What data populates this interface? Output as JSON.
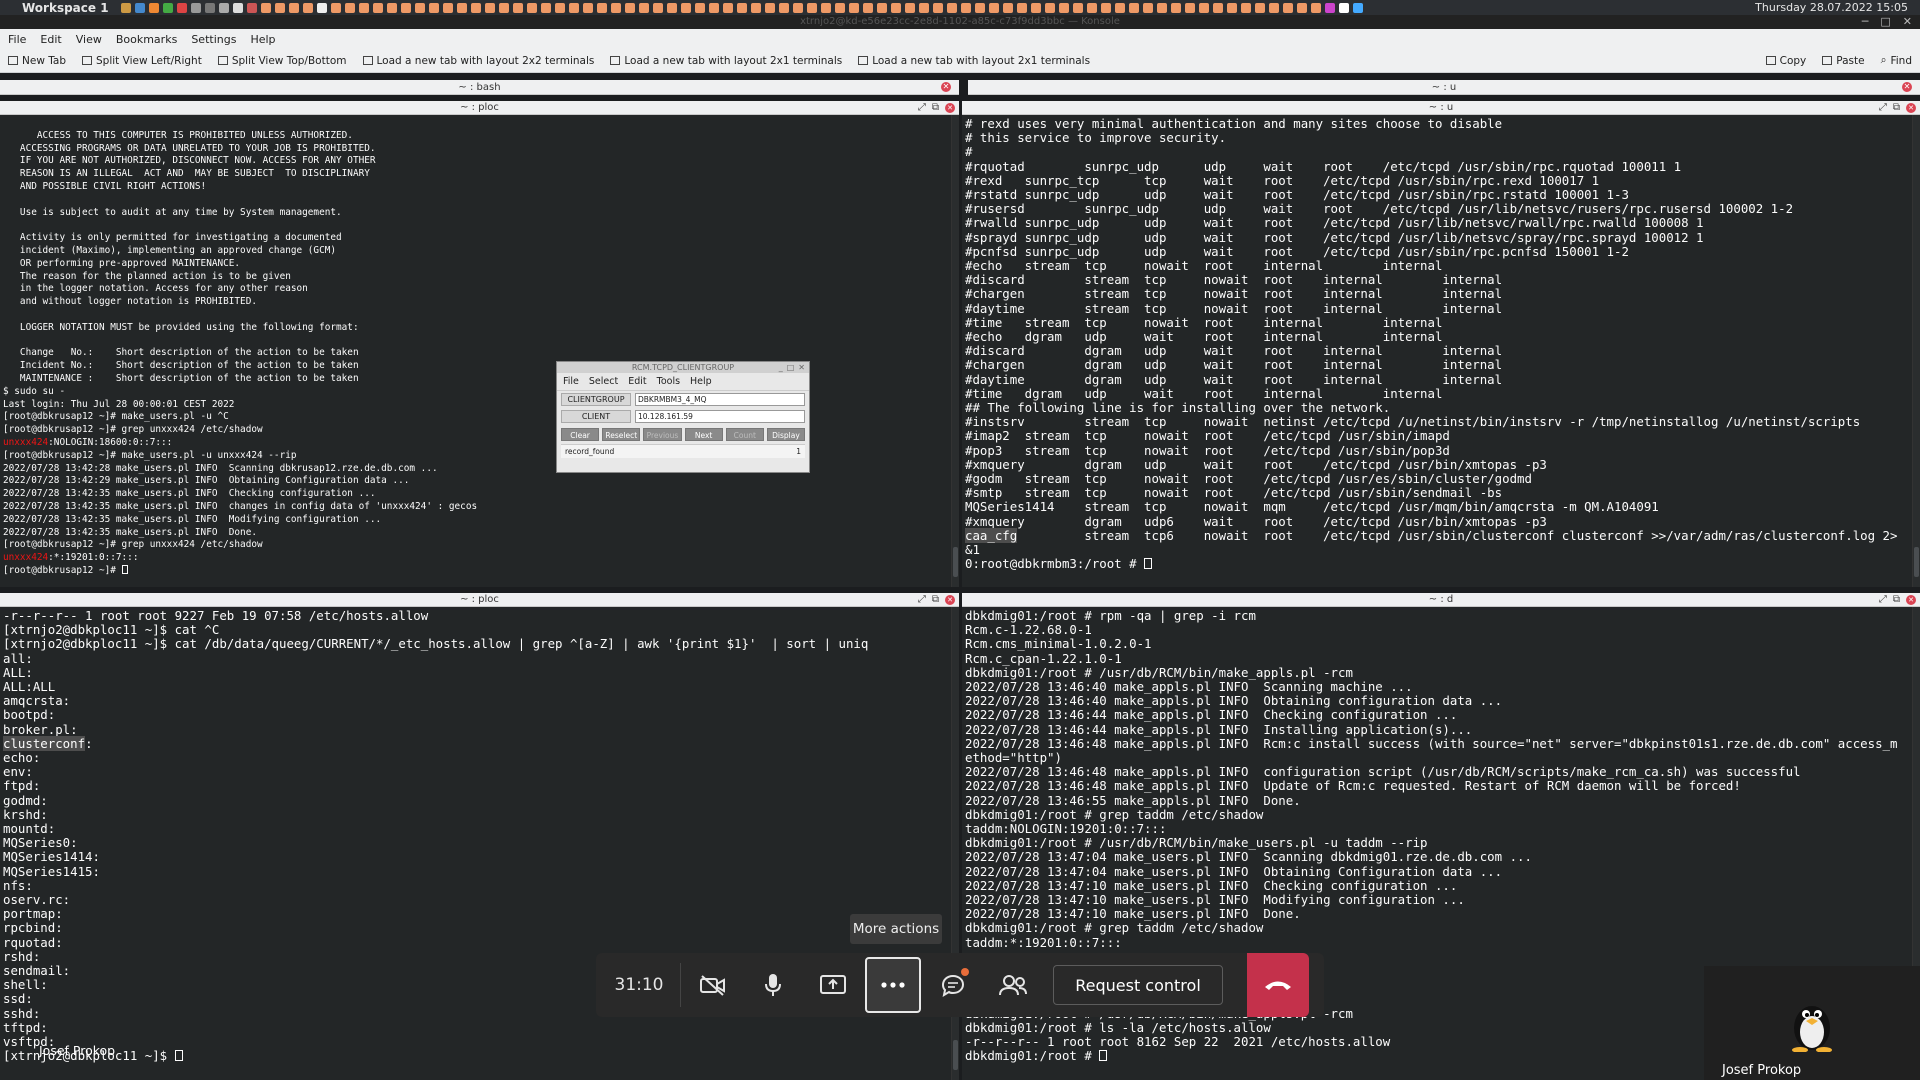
{
  "panel": {
    "workspace": "Workspace 1",
    "clock": "Thursday 28.07.2022 15:05"
  },
  "window": {
    "title": "xtrnjo2@kd-e56e23cc-2e8d-1102-a85c-c73f9dd3bbc — Konsole"
  },
  "menubar": [
    "File",
    "Edit",
    "View",
    "Bookmarks",
    "Settings",
    "Help"
  ],
  "toolbar": {
    "new_tab": "New Tab",
    "split_lr": "Split View Left/Right",
    "split_tb": "Split View Top/Bottom",
    "layout_2x2": "Load a new tab with layout 2x2 terminals",
    "layout_2x1a": "Load a new tab with layout 2x1 terminals",
    "layout_2x1b": "Load a new tab with layout 2x1 terminals",
    "copy": "Copy",
    "paste": "Paste",
    "find": "Find"
  },
  "tabs": {
    "left": "~ : bash",
    "right": "~ : u"
  },
  "panes": {
    "top_left": {
      "title": "~ : ploc",
      "lines": [
        "",
        "      ACCESS TO THIS COMPUTER IS PROHIBITED UNLESS AUTHORIZED.",
        "   ACCESSING PROGRAMS OR DATA UNRELATED TO YOUR JOB IS PROHIBITED.",
        "   IF YOU ARE NOT AUTHORIZED, DISCONNECT NOW. ACCESS FOR ANY OTHER",
        "   REASON IS AN ILLEGAL  ACT AND  MAY BE SUBJECT  TO DISCIPLINARY",
        "   AND POSSIBLE CIVIL RIGHT ACTIONS!",
        "",
        "   Use is subject to audit at any time by System management.",
        "",
        "   Activity is only permitted for investigating a documented",
        "   incident (Maximo), implementing an approved change (GCM)",
        "   OR performing pre-approved MAINTENANCE.",
        "   The reason for the planned action is to be given",
        "   in the logger notation. Access for any other reason",
        "   and without logger notation is PROHIBITED.",
        "",
        "   LOGGER NOTATION MUST be provided using the following format:",
        "",
        "   Change   No.:    Short description of the action to be taken",
        "   Incident No.:    Short description of the action to be taken",
        "   MAINTENANCE :    Short description of the action to be taken",
        "$ sudo su -",
        "Last login: Thu Jul 28 00:00:01 CEST 2022",
        "[root@dbkrusap12 ~]# make_users.pl -u ^C",
        "[root@dbkrusap12 ~]# grep unxxx424 /etc/shadow",
        "",
        "[root@dbkrusap12 ~]# make_users.pl -u unxxx424 --rip",
        "2022/07/28 13:42:28 make_users.pl INFO  Scanning dbkrusap12.rze.de.db.com ...",
        "2022/07/28 13:42:29 make_users.pl INFO  Obtaining Configuration data ...",
        "2022/07/28 13:42:35 make_users.pl INFO  Checking configuration ...",
        "2022/07/28 13:42:35 make_users.pl INFO  changes in config data of 'unxxx424' : gecos",
        "2022/07/28 13:42:35 make_users.pl INFO  Modifying configuration ...",
        "2022/07/28 13:42:35 make_users.pl INFO  Done.",
        "[root@dbkrusap12 ~]# grep unxxx424 /etc/shadow",
        ""
      ],
      "red_lines": {
        "l25_user": "unxxx424",
        "l25_rest": ":NOLOGIN:18600:0::7:::",
        "l35_user": "unxxx424",
        "l35_rest": ":*:19201:0::7:::"
      },
      "prompt": "[root@dbkrusap12 ~]# "
    },
    "top_right": {
      "title": "~ : u",
      "lines": [
        "# rexd uses very minimal authentication and many sites choose to disable",
        "# this service to improve security.",
        "#",
        "#rquotad        sunrpc_udp      udp     wait    root    /etc/tcpd /usr/sbin/rpc.rquotad 100011 1",
        "#rexd   sunrpc_tcp      tcp     wait    root    /etc/tcpd /usr/sbin/rpc.rexd 100017 1",
        "#rstatd sunrpc_udp      udp     wait    root    /etc/tcpd /usr/sbin/rpc.rstatd 100001 1-3",
        "#rusersd        sunrpc_udp      udp     wait    root    /etc/tcpd /usr/lib/netsvc/rusers/rpc.rusersd 100002 1-2",
        "#rwalld sunrpc_udp      udp     wait    root    /etc/tcpd /usr/lib/netsvc/rwall/rpc.rwalld 100008 1",
        "#sprayd sunrpc_udp      udp     wait    root    /etc/tcpd /usr/lib/netsvc/spray/rpc.sprayd 100012 1",
        "#pcnfsd sunrpc_udp      udp     wait    root    /etc/tcpd /usr/sbin/rpc.pcnfsd 150001 1-2",
        "#echo   stream  tcp     nowait  root    internal        internal",
        "#discard        stream  tcp     nowait  root    internal        internal",
        "#chargen        stream  tcp     nowait  root    internal        internal",
        "#daytime        stream  tcp     nowait  root    internal        internal",
        "#time   stream  tcp     nowait  root    internal        internal",
        "#echo   dgram   udp     wait    root    internal        internal",
        "#discard        dgram   udp     wait    root    internal        internal",
        "#chargen        dgram   udp     wait    root    internal        internal",
        "#daytime        dgram   udp     wait    root    internal        internal",
        "#time   dgram   udp     wait    root    internal        internal",
        "## The following line is for installing over the network.",
        "#instsrv        stream  tcp     nowait  netinst /etc/tcpd /u/netinst/bin/instsrv -r /tmp/netinstallog /u/netinst/scripts",
        "#imap2  stream  tcp     nowait  root    /etc/tcpd /usr/sbin/imapd",
        "#pop3   stream  tcp     nowait  root    /etc/tcpd /usr/sbin/pop3d",
        "#xmquery        dgram   udp     wait    root    /etc/tcpd /usr/bin/xmtopas -p3",
        "#godm   stream  tcp     nowait  root    /etc/tcpd /usr/es/sbin/cluster/godmd",
        "#smtp   stream  tcp     nowait  root    /etc/tcpd /usr/sbin/sendmail -bs",
        "MQSeries1414    stream  tcp     nowait  mqm     /etc/tcpd /usr/mqm/bin/amqcrsta -m QM.A104091",
        "#xmquery        dgram   udp6    wait    root    /etc/tcpd /usr/bin/xmtopas -p3"
      ],
      "hl_word": "caa_cfg",
      "hl_rest": "         stream  tcp6    nowait  root    /etc/tcpd /usr/sbin/clusterconf clusterconf >>/var/adm/ras/clusterconf.log 2>",
      "wrap": "&1",
      "prompt": "0:root@dbkrmbm3:/root # "
    },
    "bottom_left": {
      "title": "~ : ploc",
      "lines_a": [
        "-r--r--r-- 1 root root 9227 Feb 19 07:58 /etc/hosts.allow",
        "[xtrnjo2@dbkploc11 ~]$ cat ^C",
        "[xtrnjo2@dbkploc11 ~]$ cat /db/data/queeg/CURRENT/*/_etc_hosts.allow | grep ^[a-Z] | awk '{print $1}'  | sort | uniq",
        "all:",
        "ALL:",
        "ALL:ALL",
        "amqcrsta:",
        "bootpd:",
        "broker.pl:"
      ],
      "hl_word": "clusterconf",
      "hl_rest": ":",
      "lines_b": [
        "echo:",
        "env:",
        "ftpd:",
        "godmd:",
        "krshd:",
        "mountd:",
        "MQSeries0:",
        "MQSeries1414:",
        "MQSeries1415:",
        "nfs:",
        "oserv.rc:",
        "portmap:",
        "rpcbind:",
        "rquotad:",
        "rshd:",
        "sendmail:",
        "shell:",
        "ssd:",
        "sshd:",
        "tftpd:",
        "vsftpd:"
      ],
      "prompt": "[xtrnjo2@dbkploc11 ~]$ "
    },
    "bottom_right": {
      "title": "~ : d",
      "lines": [
        "dbkdmig01:/root # rpm -qa | grep -i rcm",
        "Rcm.c-1.22.68.0-1",
        "Rcm.cms_minimal-1.0.2.0-1",
        "Rcm.c_cpan-1.22.1.0-1",
        "dbkdmig01:/root # /usr/db/RCM/bin/make_appls.pl -rcm",
        "2022/07/28 13:46:40 make_appls.pl INFO  Scanning machine ...",
        "2022/07/28 13:46:40 make_appls.pl INFO  Obtaining configuration data ...",
        "2022/07/28 13:46:44 make_appls.pl INFO  Checking configuration ...",
        "2022/07/28 13:46:44 make_appls.pl INFO  Installing application(s)...",
        "2022/07/28 13:46:48 make_appls.pl INFO  Rcm:c install success (with source=\"net\" server=\"dbkpinst01s1.rze.de.db.com\" access_m",
        "ethod=\"http\")",
        "2022/07/28 13:46:48 make_appls.pl INFO  configuration script (/usr/db/RCM/scripts/make_rcm_ca.sh) was successful",
        "2022/07/28 13:46:48 make_appls.pl INFO  Update of Rcm:c requested. Restart of RCM daemon will be forced!",
        "2022/07/28 13:46:55 make_appls.pl INFO  Done.",
        "dbkdmig01:/root # grep taddm /etc/shadow",
        "taddm:NOLOGIN:19201:0::7:::",
        "dbkdmig01:/root # /usr/db/RCM/bin/make_users.pl -u taddm --rip",
        "2022/07/28 13:47:04 make_users.pl INFO  Scanning dbkdmig01.rze.de.db.com ...",
        "2022/07/28 13:47:04 make_users.pl INFO  Obtaining Configuration data ...",
        "2022/07/28 13:47:10 make_users.pl INFO  Checking configuration ...",
        "2022/07/28 13:47:10 make_users.pl INFO  Modifying configuration ...",
        "2022/07/28 13:47:10 make_users.pl INFO  Done.",
        "dbkdmig01:/root # grep taddm /etc/shadow",
        "taddm:*:19201:0::7:::",
        "",
        "",
        "",
        "",
        "dbkdmig01:/root # /usr/db/RCM/bin/make_appls.pl -rcm",
        "dbkdmig01:/root # ls -la /etc/hosts.allow",
        "-r--r--r-- 1 root root 8162 Sep 22  2021 /etc/hosts.allow"
      ],
      "prompt": "dbkdmig01:/root # "
    }
  },
  "dialog": {
    "title": "RCM.TCPD_CLIENTGROUP",
    "menu": [
      "File",
      "Select",
      "Edit",
      "Tools",
      "Help"
    ],
    "clientgroup_label": "CLIENTGROUP",
    "clientgroup_value": "DBKRMBM3_4_MQ",
    "client_label": "CLIENT",
    "client_value": "10.128.161.59",
    "buttons": [
      "Clear",
      "Reselect",
      "Previous",
      "Next",
      "Count",
      "Display"
    ],
    "status_left": "record_found",
    "status_right": "1"
  },
  "meeting": {
    "timer": "31:10",
    "tooltip": "More actions",
    "request_control": "Request control",
    "participant": "Josef Prokop",
    "presenter_label": "Josef Prokop"
  }
}
